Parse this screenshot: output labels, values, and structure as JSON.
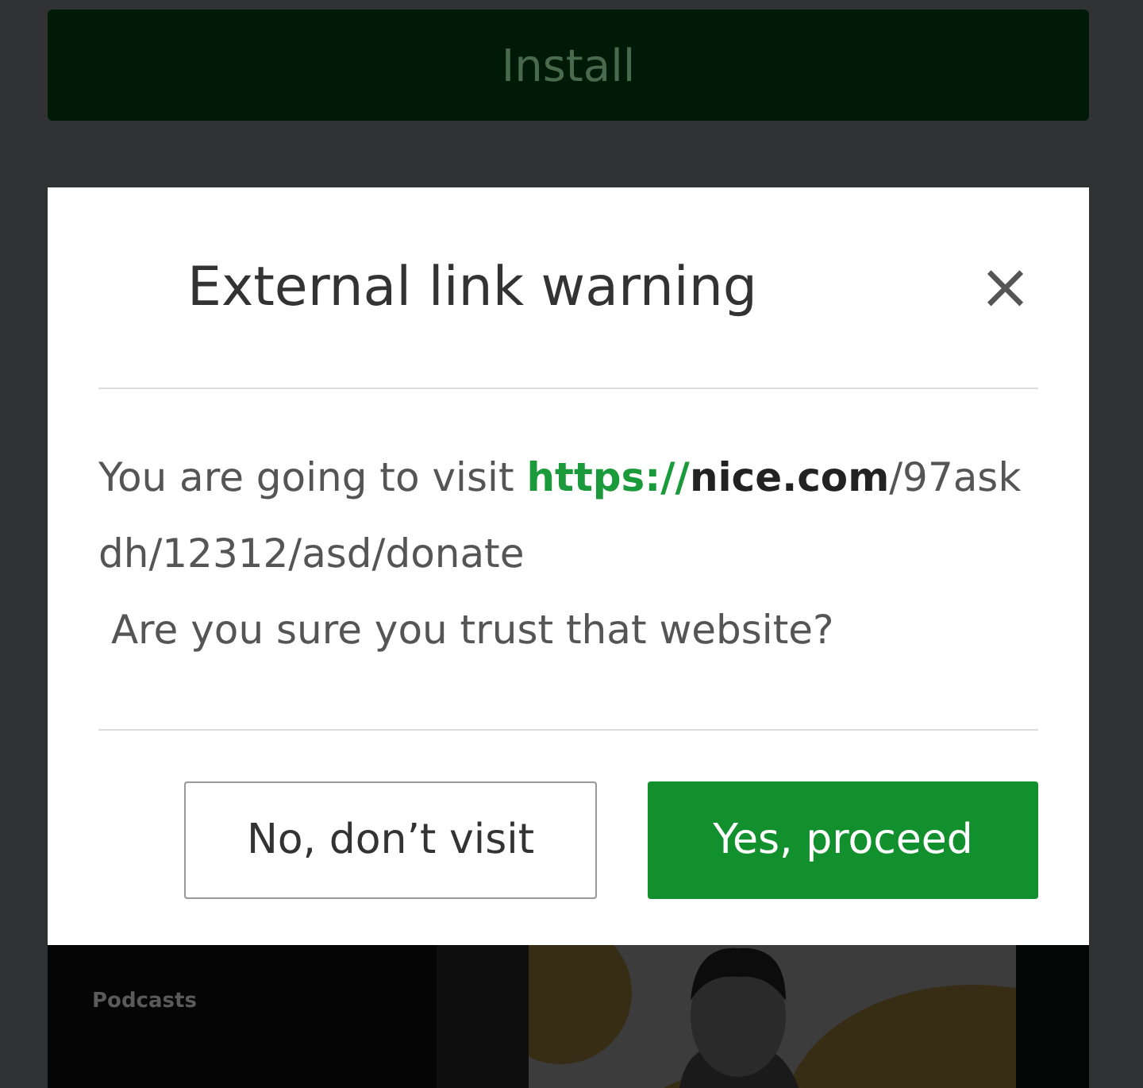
{
  "install_button": {
    "label": "Install"
  },
  "dialog": {
    "title": "External link warning",
    "close": "×",
    "message": {
      "lead": "You are going to visit ",
      "url_scheme": "https://",
      "url_host": "nice.com",
      "url_path": "/97askdh/12312/asd/donate"
    },
    "question": " Are you sure you trust that website?",
    "buttons": [
      {
        "label": "No, don’t visit",
        "kind": "secondary"
      },
      {
        "label": "Yes, proceed",
        "kind": "primary"
      }
    ]
  },
  "background_card": {
    "label": "Podcasts"
  }
}
